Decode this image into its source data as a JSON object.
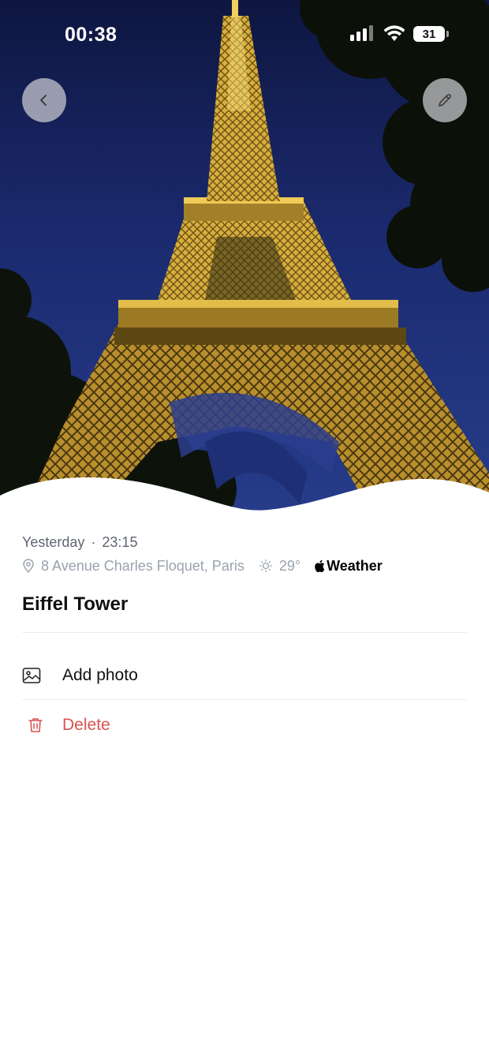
{
  "status_bar": {
    "time": "00:38",
    "battery": "31"
  },
  "entry": {
    "date_label": "Yesterday",
    "separator": "·",
    "time": "23:15",
    "address": "8 Avenue Charles Floquet, Paris",
    "temperature": "29°",
    "weather_brand": "Weather",
    "title": "Eiffel Tower"
  },
  "actions": {
    "add_photo_label": "Add photo",
    "delete_label": "Delete"
  },
  "colors": {
    "delete": "#d9534f",
    "secondary_text": "#5f6672",
    "muted_text": "#9aa2ae",
    "sky": "#1c2a6b",
    "tower_light": "#e8c046"
  },
  "icons": {
    "back": "chevron-left-icon",
    "edit": "pencil-icon",
    "location": "location-pin-icon",
    "weather": "sun-icon",
    "add_photo": "image-icon",
    "delete": "trash-icon"
  }
}
